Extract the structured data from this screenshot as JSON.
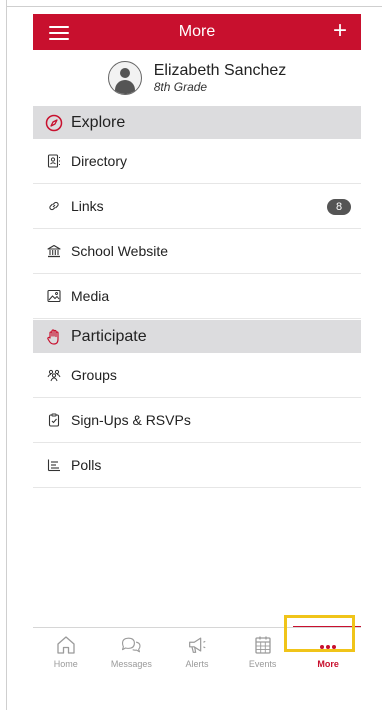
{
  "header": {
    "title": "More"
  },
  "profile": {
    "name": "Elizabeth Sanchez",
    "grade": "8th Grade"
  },
  "sections": [
    {
      "label": "Explore",
      "icon": "compass-icon",
      "items": [
        {
          "label": "Directory",
          "icon": "contact-card-icon"
        },
        {
          "label": "Links",
          "icon": "link-icon",
          "badge": "8"
        },
        {
          "label": "School Website",
          "icon": "school-building-icon"
        },
        {
          "label": "Media",
          "icon": "image-icon"
        }
      ]
    },
    {
      "label": "Participate",
      "icon": "raised-hand-icon",
      "items": [
        {
          "label": "Groups",
          "icon": "people-icon"
        },
        {
          "label": "Sign-Ups & RSVPs",
          "icon": "clipboard-check-icon"
        },
        {
          "label": "Polls",
          "icon": "poll-icon"
        }
      ]
    }
  ],
  "tabs": [
    {
      "label": "Home",
      "icon": "home-icon"
    },
    {
      "label": "Messages",
      "icon": "chat-bubbles-icon"
    },
    {
      "label": "Alerts",
      "icon": "megaphone-icon"
    },
    {
      "label": "Events",
      "icon": "calendar-icon"
    },
    {
      "label": "More",
      "icon": "more-dots-icon",
      "active": true
    }
  ],
  "colors": {
    "brand": "#c8102e",
    "section_bg": "#dcdcde",
    "highlight": "#f0c419"
  }
}
